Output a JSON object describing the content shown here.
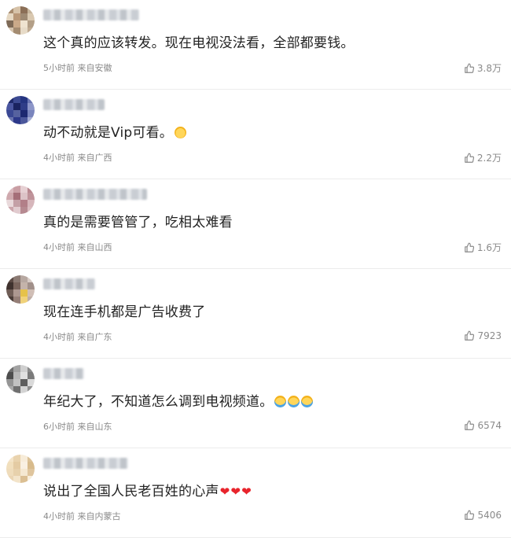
{
  "comments": [
    {
      "text": "这个真的应该转发。现在电视没法看，全部都要钱。",
      "emoji": "",
      "time": "5小时前",
      "location": "来自安徽",
      "likes": "3.8万",
      "avatar": [
        "#a78b6e",
        "#d6c2a8",
        "#8b6f57",
        "#c6b59c",
        "#e5d7c2",
        "#b89777",
        "#9e8a73",
        "#d9c8b0",
        "#7e6a57",
        "#caa989",
        "#efe3d0",
        "#b39f87",
        "#d4c3ad",
        "#a48c71",
        "#e7dbc8",
        "#c0ab92"
      ]
    },
    {
      "text": "动不动就是Vip可看。",
      "emoji": "party",
      "time": "4小时前",
      "location": "来自广西",
      "likes": "2.2万",
      "avatar": [
        "#1f2a6b",
        "#3c4a92",
        "#243480",
        "#6b76b3",
        "#4a56a0",
        "#1a2360",
        "#2f3d88",
        "#8d96c8",
        "#3a4894",
        "#56629f",
        "#1c2870",
        "#7a85bd",
        "#6b75ae",
        "#2c388a",
        "#4b579b",
        "#a3abd3"
      ]
    },
    {
      "text": "真的是需要管管了，吃相太难看",
      "emoji": "",
      "time": "4小时前",
      "location": "来自山西",
      "likes": "1.6万",
      "avatar": [
        "#d9b8bd",
        "#c99ea4",
        "#e6d0d3",
        "#b98890",
        "#cfa9ae",
        "#a56e78",
        "#dcc3c7",
        "#bf939a",
        "#e9d9db",
        "#c4a0a6",
        "#b27f88",
        "#d6b6bb",
        "#cba5ab",
        "#e1cbcf",
        "#b68a91",
        "#dabdc1"
      ]
    },
    {
      "text": "现在连手机都是广告收费了",
      "emoji": "",
      "time": "4小时前",
      "location": "来自广东",
      "likes": "7923",
      "avatar": [
        "#5b4a44",
        "#8b7a73",
        "#b7a8a1",
        "#d8ccc6",
        "#3f322e",
        "#7a655d",
        "#c4b3aa",
        "#a1908a",
        "#6f5d56",
        "#ad9890",
        "#e6c24a",
        "#d0beb6",
        "#4b3d38",
        "#957f77",
        "#f0d27a",
        "#bfae a6"
      ]
    },
    {
      "text": "年纪大了，不知道怎么调到电视频道。",
      "emoji": "laugh3",
      "time": "6小时前",
      "location": "来自山东",
      "likes": "6574",
      "avatar": [
        "#6e6e6e",
        "#a3a3a3",
        "#cfcfcf",
        "#8a8a8a",
        "#4d4d4d",
        "#b8b8b8",
        "#e0e0e0",
        "#7a7a7a",
        "#959595",
        "#c2c2c2",
        "#5e5e5e",
        "#dadada",
        "#aaaaaa",
        "#707070",
        "#d3d3d3",
        "#8f8f8f"
      ]
    },
    {
      "text": "说出了全国人民老百姓的心声",
      "emoji": "hearts",
      "time": "4小时前",
      "location": "来自内蒙古",
      "likes": "5406",
      "avatar": [
        "#f4e4c8",
        "#e9d3ae",
        "#f7ecd9",
        "#dcc298",
        "#f1dfbd",
        "#e4cba3",
        "#f9f0e2",
        "#d8bb8c",
        "#efdcbb",
        "#e7d1ac",
        "#f5e8d1",
        "#dfc59d",
        "#ead5b3",
        "#f3e4ca",
        "#dbbf93",
        "#f8eedc"
      ]
    }
  ],
  "name_blur_widths": [
    122,
    78,
    132,
    66,
    52,
    108
  ]
}
